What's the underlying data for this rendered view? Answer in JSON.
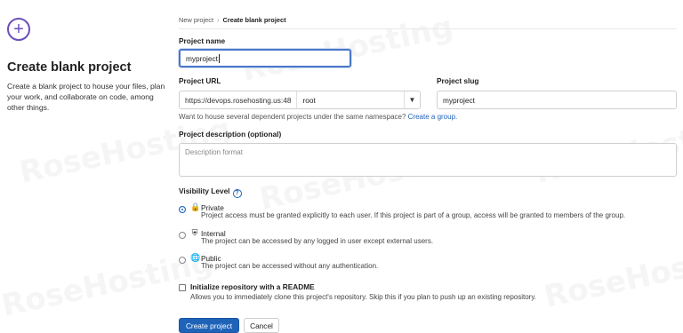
{
  "left_panel": {
    "icon": "plus-circle-icon",
    "heading": "Create blank project",
    "description": "Create a blank project to house your files, plan your work, and collaborate on code, among other things."
  },
  "breadcrumb": {
    "parent": "New project",
    "separator": "›",
    "current": "Create blank project"
  },
  "form": {
    "project_name": {
      "label": "Project name",
      "value": "myproject"
    },
    "project_url": {
      "label": "Project URL",
      "prefix": "https://devops.rosehosting.us:48",
      "namespace": "root"
    },
    "project_slug": {
      "label": "Project slug",
      "value": "myproject"
    },
    "group_hint": {
      "text": "Want to house several dependent projects under the same namespace?",
      "link": "Create a group."
    },
    "description": {
      "label": "Project description (optional)",
      "placeholder": "Description format"
    },
    "visibility": {
      "label": "Visibility Level",
      "help_icon": "question-circle-icon",
      "options": [
        {
          "icon": "lock-icon",
          "title": "Private",
          "desc": "Project access must be granted explicitly to each user. If this project is part of a group, access will be granted to members of the group.",
          "selected": true
        },
        {
          "icon": "shield-icon",
          "title": "Internal",
          "desc": "The project can be accessed by any logged in user except external users.",
          "selected": false
        },
        {
          "icon": "globe-icon",
          "title": "Public",
          "desc": "The project can be accessed without any authentication.",
          "selected": false
        }
      ]
    },
    "init_readme": {
      "label": "Initialize repository with a README",
      "desc": "Allows you to immediately clone this project's repository. Skip this if you plan to push up an existing repository.",
      "checked": false
    },
    "create_button": "Create project",
    "cancel_button": "Cancel"
  },
  "colors": {
    "accent": "#1f63b9",
    "brand_purple": "#6b4fbb",
    "focus_border": "#4a77c9"
  }
}
